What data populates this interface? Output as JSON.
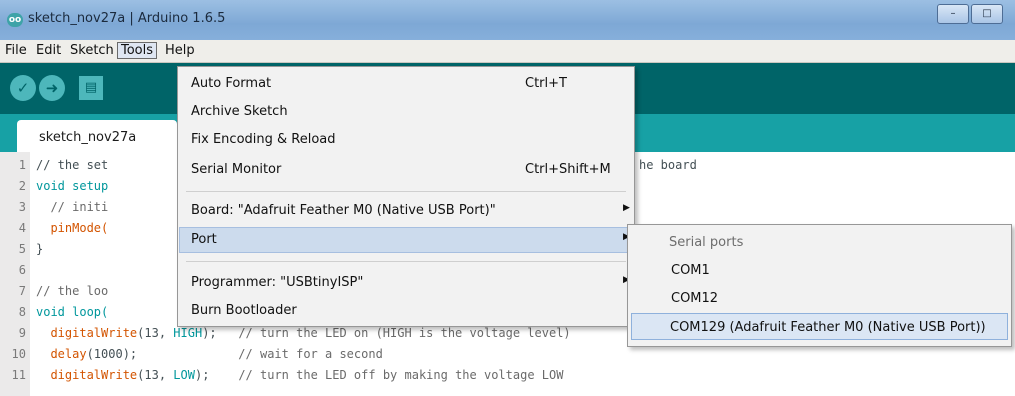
{
  "window": {
    "title": "sketch_nov27a | Arduino 1.6.5",
    "icon_glyph": "oo",
    "controls": [
      "–",
      "□"
    ]
  },
  "menubar": {
    "items": [
      "File",
      "Edit",
      "Sketch",
      "Tools",
      "Help"
    ],
    "open_item": "Tools"
  },
  "toolbar": {
    "buttons": [
      {
        "name": "verify-icon",
        "glyph": "✓"
      },
      {
        "name": "upload-icon",
        "glyph": "➜"
      },
      {
        "name": "new-icon",
        "glyph": "▤"
      }
    ]
  },
  "editor": {
    "tab_label": "sketch_nov27a",
    "line_numbers": [
      "1",
      "2",
      "3",
      "4",
      "5",
      "6",
      "7",
      "8",
      "9",
      "10",
      "11"
    ],
    "lines": [
      "// the set",
      "void setup",
      "  // initi",
      "  pinMode(",
      "}",
      "",
      "// the loo",
      "void loop(",
      "  digitalWrite(13, HIGH);   // turn the LED on (HIGH is the voltage level)",
      "  delay(1000);              // wait for a second",
      "  digitalWrite(13, LOW);    // turn the LED off by making the voltage LOW"
    ],
    "line1_tail": "he board"
  },
  "tools_menu": {
    "items": [
      {
        "label": "Auto Format",
        "shortcut": "Ctrl+T"
      },
      {
        "label": "Archive Sketch",
        "shortcut": ""
      },
      {
        "label": "Fix Encoding & Reload",
        "shortcut": ""
      },
      {
        "label": "Serial Monitor",
        "shortcut": "Ctrl+Shift+M"
      },
      {
        "label": "Board: \"Adafruit Feather M0 (Native USB Port)\"",
        "submenu": true
      },
      {
        "label": "Port",
        "submenu": true,
        "highlighted": true
      },
      {
        "label": "Programmer: \"USBtinyISP\"",
        "submenu": true
      },
      {
        "label": "Burn Bootloader",
        "shortcut": ""
      }
    ]
  },
  "port_submenu": {
    "header": "Serial ports",
    "items": [
      {
        "label": "COM1"
      },
      {
        "label": "COM12"
      },
      {
        "label": "COM129 (Adafruit Feather M0 (Native USB Port))",
        "highlighted": true
      }
    ]
  },
  "colors": {
    "toolbar_bg": "#006468",
    "tab_strip_bg": "#17a1a5",
    "toolbar_button": "#4db7bb",
    "keyword": "#00979c",
    "function": "#d35400",
    "menu_highlight": "#ccdbed"
  }
}
